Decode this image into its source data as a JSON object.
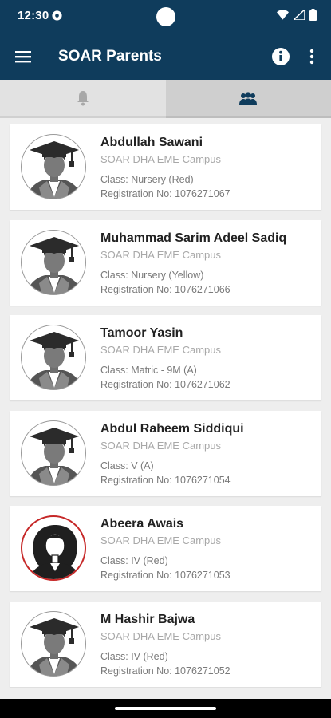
{
  "status_bar": {
    "time": "12:30",
    "icons": [
      "settings-icon",
      "wifi-icon",
      "signal-icon",
      "battery-icon"
    ]
  },
  "app_bar": {
    "title": "SOAR Parents",
    "color": "#0f3c5c",
    "icons": [
      "menu-icon",
      "info-icon",
      "more-vert-icon"
    ]
  },
  "tabs": [
    {
      "icon": "bell-icon",
      "selected": false
    },
    {
      "icon": "people-icon",
      "selected": true
    }
  ],
  "students": [
    {
      "name": "Abdullah Sawani",
      "campus": "SOAR DHA EME Campus",
      "class": "Class: Nursery (Red)",
      "registration": "Registration No: 1076271067",
      "avatar": "graduate-male-icon"
    },
    {
      "name": "Muhammad Sarim Adeel Sadiq",
      "campus": "SOAR DHA EME Campus",
      "class": "Class: Nursery (Yellow)",
      "registration": "Registration No: 1076271066",
      "avatar": "graduate-male-icon"
    },
    {
      "name": "Tamoor Yasin",
      "campus": "SOAR DHA EME Campus",
      "class": "Class: Matric - 9M (A)",
      "registration": "Registration No: 1076271062",
      "avatar": "graduate-male-icon"
    },
    {
      "name": "Abdul Raheem Siddiqui",
      "campus": "SOAR DHA EME Campus",
      "class": "Class: V (A)",
      "registration": "Registration No: 1076271054",
      "avatar": "graduate-male-icon"
    },
    {
      "name": "Abeera Awais",
      "campus": "SOAR DHA EME Campus",
      "class": "Class: IV (Red)",
      "registration": "Registration No: 1076271053",
      "avatar": "female-student-icon"
    },
    {
      "name": "M Hashir Bajwa",
      "campus": "SOAR DHA EME Campus",
      "class": "Class: IV (Red)",
      "registration": "Registration No: 1076271052",
      "avatar": "graduate-male-icon"
    }
  ]
}
